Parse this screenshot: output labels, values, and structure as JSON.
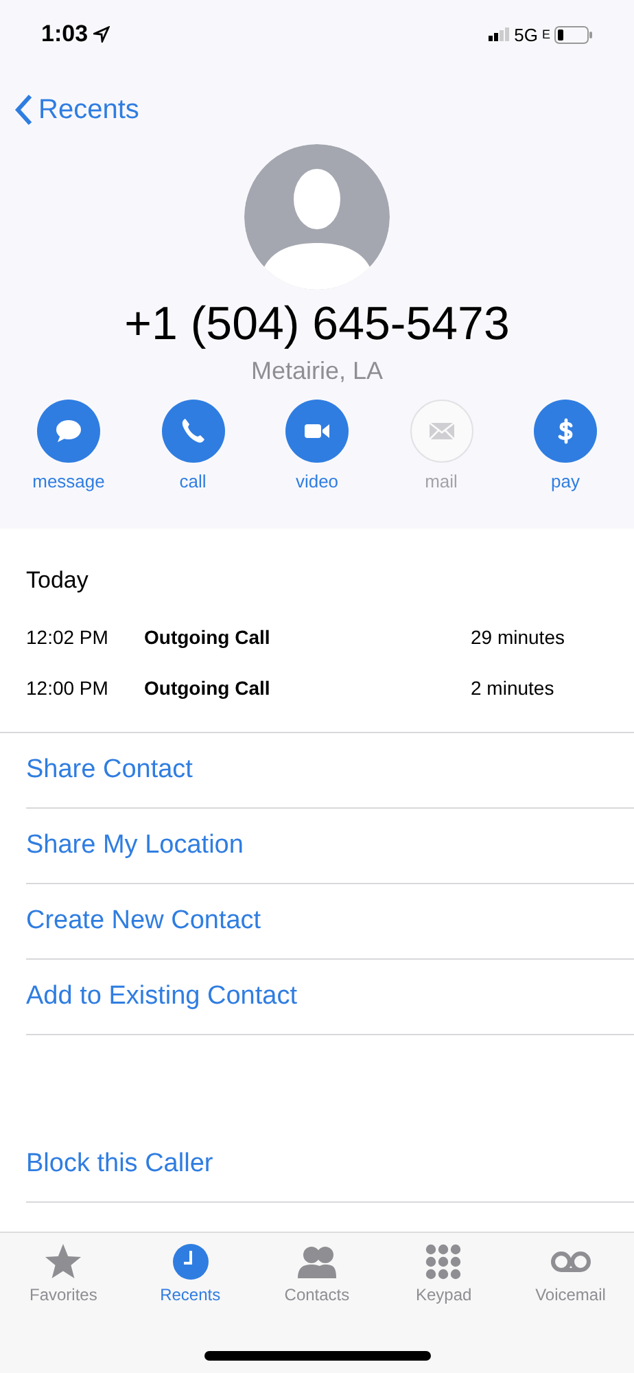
{
  "status_bar": {
    "time": "1:03",
    "network": "5G",
    "network_sub": "E"
  },
  "nav": {
    "back": "Recents"
  },
  "contact": {
    "number": "+1 (504) 645-5473",
    "location": "Metairie, LA"
  },
  "actions": [
    {
      "kind": "message",
      "label": "message",
      "disabled": false
    },
    {
      "kind": "call",
      "label": "call",
      "disabled": false
    },
    {
      "kind": "video",
      "label": "video",
      "disabled": false
    },
    {
      "kind": "mail",
      "label": "mail",
      "disabled": true
    },
    {
      "kind": "pay",
      "label": "pay",
      "disabled": false
    }
  ],
  "history": {
    "heading": "Today",
    "calls": [
      {
        "time": "12:02 PM",
        "type": "Outgoing Call",
        "duration": "29 minutes"
      },
      {
        "time": "12:00 PM",
        "type": "Outgoing Call",
        "duration": "2 minutes"
      }
    ]
  },
  "links": [
    "Share Contact",
    "Share My Location",
    "Create New Contact",
    "Add to Existing Contact"
  ],
  "block": "Block this Caller",
  "tabs": [
    {
      "kind": "favorites",
      "label": "Favorites",
      "selected": false
    },
    {
      "kind": "recents",
      "label": "Recents",
      "selected": true
    },
    {
      "kind": "contacts",
      "label": "Contacts",
      "selected": false
    },
    {
      "kind": "keypad",
      "label": "Keypad",
      "selected": false
    },
    {
      "kind": "voicemail",
      "label": "Voicemail",
      "selected": false
    }
  ]
}
